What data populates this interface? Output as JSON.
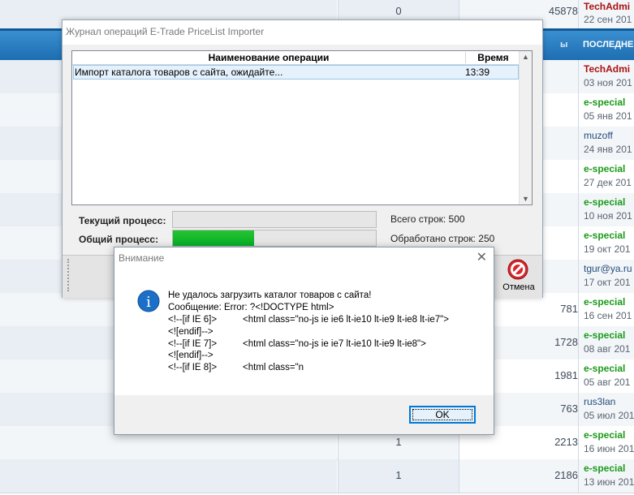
{
  "forum": {
    "header": {
      "col_suffix": "ы",
      "last_post": "ПОСЛЕДНЕЕ"
    },
    "top_row": {
      "replies": "0",
      "views": "45878",
      "author": "TechAdmi",
      "date": "22 сен 201"
    },
    "rows": [
      {
        "replies": "",
        "views": "",
        "author": "TechAdmi",
        "author_color": "red",
        "date": "03 ноя 201"
      },
      {
        "replies": "",
        "views": "",
        "author": "e-special",
        "author_color": "green",
        "date": "05 янв 201"
      },
      {
        "replies": "",
        "views": "",
        "author": "muzoff",
        "author_color": "blue",
        "date": "24 янв 201"
      },
      {
        "replies": "",
        "views": "",
        "author": "e-special",
        "author_color": "green",
        "date": "27 дек 201"
      },
      {
        "replies": "",
        "views": "",
        "author": "e-special",
        "author_color": "green",
        "date": "10 ноя 201"
      },
      {
        "replies": "",
        "views": "",
        "author": "e-special",
        "author_color": "green",
        "date": "19 окт 201"
      },
      {
        "replies": "",
        "views": "",
        "author": "tgur@ya.ru",
        "author_color": "blue",
        "date": "17 окт 201"
      },
      {
        "replies": "",
        "views": "781",
        "author": "e-special",
        "author_color": "green",
        "date": "16 сен 201"
      },
      {
        "replies": "",
        "views": "1728",
        "author": "e-special",
        "author_color": "green",
        "date": "08 авг 201"
      },
      {
        "replies": "",
        "views": "1981",
        "author": "e-special",
        "author_color": "green",
        "date": "05 авг 201"
      },
      {
        "replies": "",
        "views": "763",
        "author": "rus3lan",
        "author_color": "blue",
        "date": "05 июл 201"
      },
      {
        "replies": "1",
        "views": "2213",
        "author": "e-special",
        "author_color": "green",
        "date": "16 июн 201"
      },
      {
        "replies": "1",
        "views": "2186",
        "author": "e-special",
        "author_color": "green",
        "date": "13 июн 201"
      }
    ]
  },
  "journal": {
    "title": "Журнал операций E-Trade PriceList Importer",
    "columns": {
      "name": "Наименование операции",
      "time": "Время"
    },
    "operations": [
      {
        "name": "Импорт каталога товаров с сайта, ожидайте...",
        "time": "13:39"
      }
    ],
    "current_process_label": "Текущий процесс:",
    "current_process_progress": 0,
    "overall_process_label": "Общий процесс:",
    "overall_process_progress": 0.4,
    "total_rows_label": "Всего строк: 500",
    "processed_rows_label": "Обработано строк: 250",
    "cancel_label": "Отмена"
  },
  "alert": {
    "title": "Внимание",
    "close_glyph": "✕",
    "info_glyph": "i",
    "message_lines": [
      "Не удалось загрузить каталог товаров с сайта!",
      "Сообщение: Error: ?<!DOCTYPE html>",
      "<!--[if IE 6]>          <html class=\"no-js ie ie6 lt-ie10 lt-ie9 lt-ie8 lt-ie7\">",
      "<![endif]-->",
      "<!--[if IE 7]>          <html class=\"no-js ie ie7 lt-ie10 lt-ie9 lt-ie8\">",
      "<![endif]-->",
      "<!--[if IE 8]>          <html class=\"n"
    ],
    "ok_label": "OK"
  },
  "colors": {
    "forum_header": "#1d6eb2",
    "progress_fill": "#06b025",
    "focus_border": "#0078d7",
    "stop_red": "#d8262a",
    "info_blue": "#1c6fc7"
  }
}
